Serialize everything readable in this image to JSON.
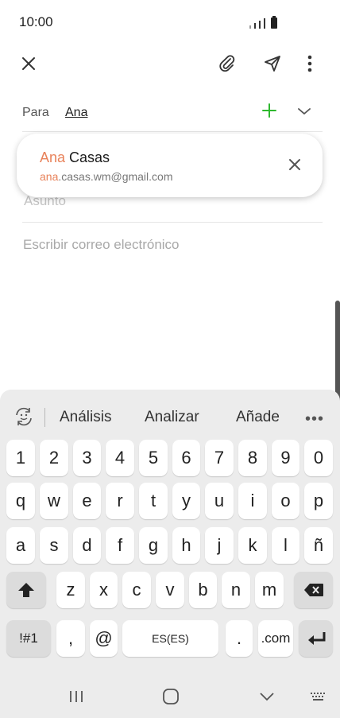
{
  "status": {
    "time": "10:00"
  },
  "toolbar": {
    "close_icon": "close-icon",
    "attach_icon": "paperclip-icon",
    "send_icon": "send-icon",
    "more_icon": "more-vertical-icon"
  },
  "compose": {
    "to_label": "Para",
    "recipient_chip": "Ana",
    "subject_placeholder": "Asunto",
    "body_placeholder": "Escribir correo electrónico"
  },
  "suggestion": {
    "name_match": "Ana",
    "name_rest": " Casas",
    "email_match": "ana",
    "email_rest": ".casas.wm@gmail.com"
  },
  "keyboard": {
    "suggestions": [
      "Análisis",
      "Analizar",
      "Añade"
    ],
    "more": "•••",
    "row_numbers": [
      "1",
      "2",
      "3",
      "4",
      "5",
      "6",
      "7",
      "8",
      "9",
      "0"
    ],
    "row1": [
      "q",
      "w",
      "e",
      "r",
      "t",
      "y",
      "u",
      "i",
      "o",
      "p"
    ],
    "row2": [
      "a",
      "s",
      "d",
      "f",
      "g",
      "h",
      "j",
      "k",
      "l",
      "ñ"
    ],
    "row3": [
      "z",
      "x",
      "c",
      "v",
      "b",
      "n",
      "m"
    ],
    "sym": "!#1",
    "comma": ",",
    "at": "@",
    "space": "ES(ES)",
    "period": ".",
    "dotcom": ".com"
  },
  "colors": {
    "accent_add": "#2eb82e",
    "highlight": "#e8825a"
  }
}
